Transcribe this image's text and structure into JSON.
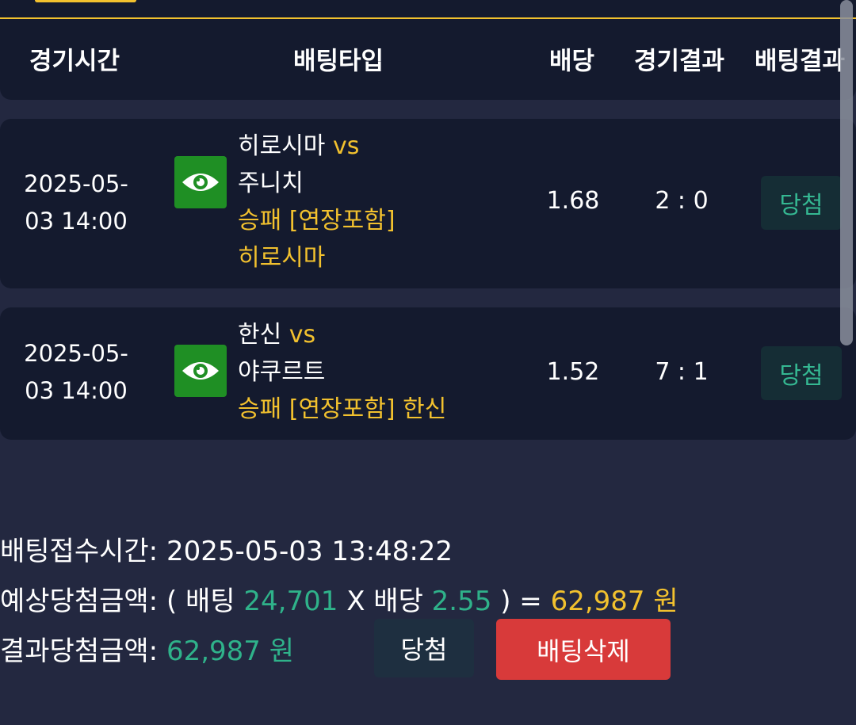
{
  "header": {
    "col_time": "경기시간",
    "col_bet_type": "배팅타입",
    "col_odds": "배당",
    "col_game_result": "경기결과",
    "col_bet_result": "배팅결과"
  },
  "bets": [
    {
      "time_line1": "2025-05-",
      "time_line2": "03 14:00",
      "home": "히로시마",
      "vs": "vs",
      "away": "주니치",
      "market": "승패 [연장포함]",
      "pick": "히로시마",
      "odds": "1.68",
      "score": "2 : 0",
      "result": "당첨"
    },
    {
      "time_line1": "2025-05-",
      "time_line2": "03 14:00",
      "home": "한신",
      "vs": "vs",
      "away": "야쿠르트",
      "market": "승패 [연장포함]",
      "pick": "한신",
      "odds": "1.52",
      "score": "7 : 1",
      "result": "당첨"
    }
  ],
  "summary": {
    "accept_label": "배팅접수시간:",
    "accept_time": "2025-05-03 13:48:22",
    "expected_label": "예상당첨금액:",
    "open_paren": "( 배팅",
    "stake": "24,701",
    "times_label": "X 배당",
    "total_odds": "2.55",
    "close_eq": ") =",
    "expected_amount": "62,987 원",
    "result_label": "결과당첨금액:",
    "result_amount": "62,987 원"
  },
  "buttons": {
    "win_label": "당첨",
    "delete_label": "배팅삭제"
  },
  "colors": {
    "accent_gold": "#f2c12e",
    "win_green": "#2fb28a",
    "delete_red": "#d83a3a",
    "eye_green": "#1f8f24"
  },
  "icons": {
    "view": "eye-icon"
  }
}
